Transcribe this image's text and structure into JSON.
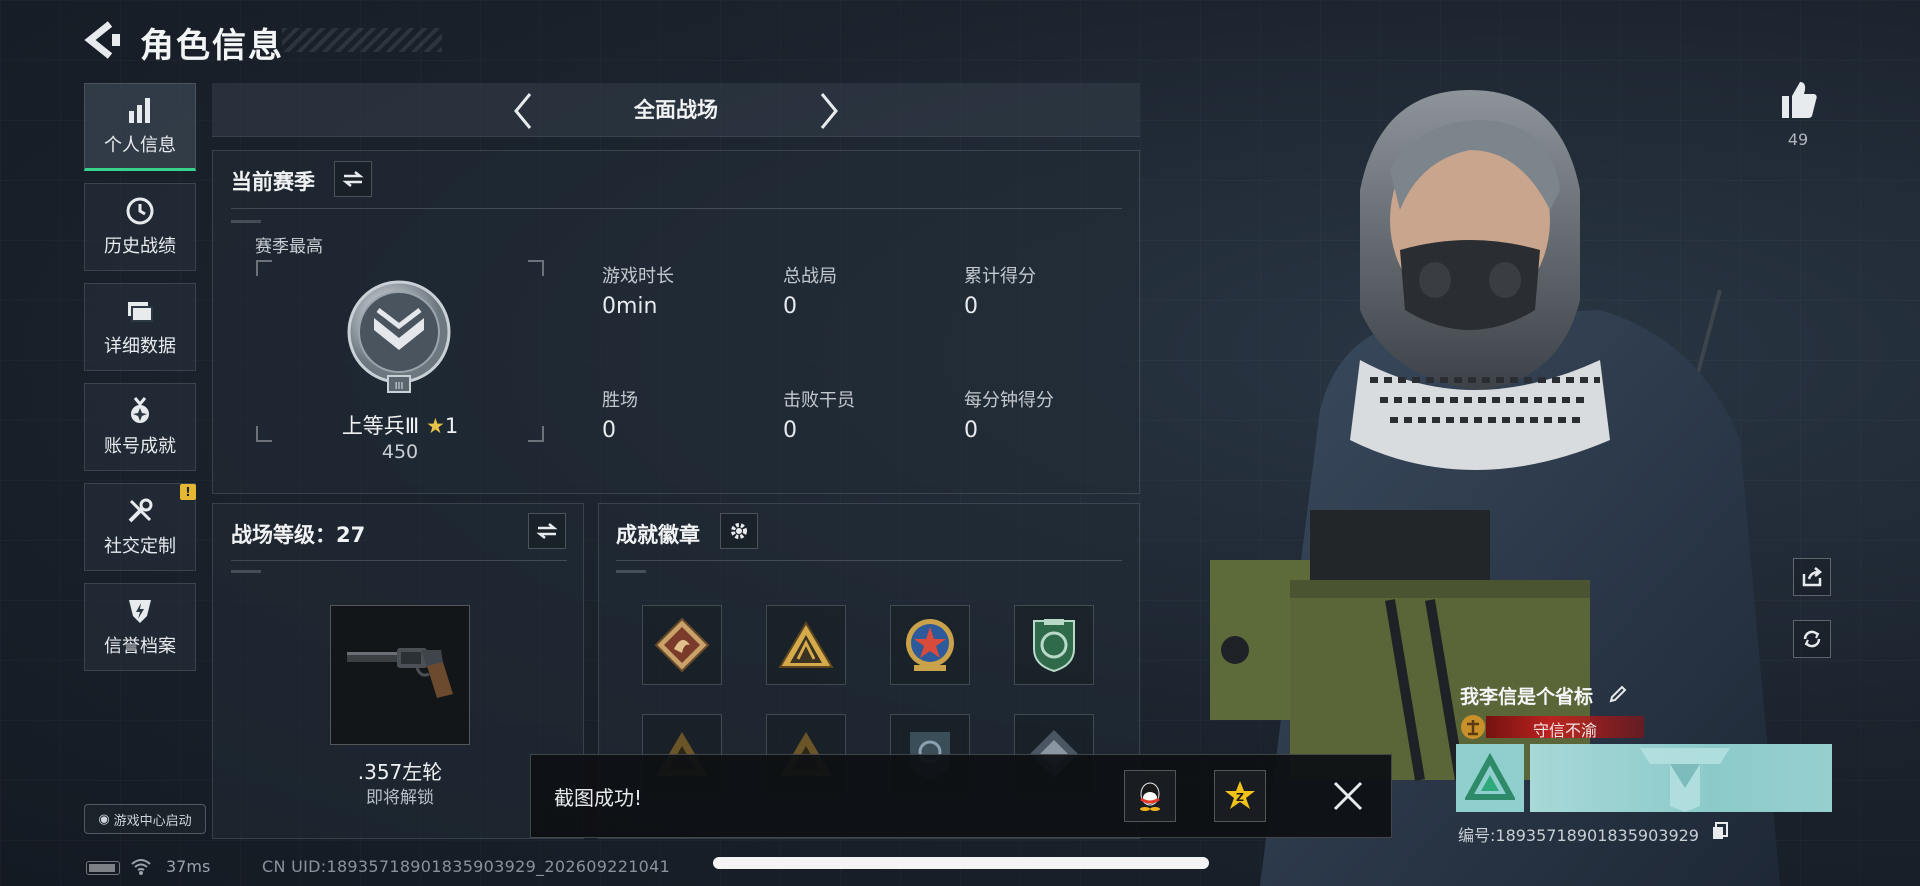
{
  "header": {
    "title": "角色信息"
  },
  "sidebar": {
    "items": [
      {
        "label": "个人信息",
        "icon": "bar-chart-icon",
        "active": true
      },
      {
        "label": "历史战绩",
        "icon": "clock-history-icon"
      },
      {
        "label": "详细数据",
        "icon": "folder-icon"
      },
      {
        "label": "账号成就",
        "icon": "medal-icon"
      },
      {
        "label": "社交定制",
        "icon": "tools-icon",
        "badge": "!"
      },
      {
        "label": "信誉档案",
        "icon": "shield-bolt-icon"
      }
    ],
    "game_center_label": "游戏中心启动"
  },
  "mode_selector": {
    "label": "全面战场"
  },
  "season": {
    "title": "当前赛季",
    "best_label": "赛季最高",
    "rank_name": "上等兵Ⅲ",
    "rank_stars": "1",
    "rank_score": "450",
    "stats": [
      {
        "label": "游戏时长",
        "value": "0min"
      },
      {
        "label": "总战局",
        "value": "0"
      },
      {
        "label": "累计得分",
        "value": "0"
      },
      {
        "label": "胜场",
        "value": "0"
      },
      {
        "label": "击败干员",
        "value": "0"
      },
      {
        "label": "每分钟得分",
        "value": "0"
      }
    ]
  },
  "battlefield_level": {
    "label": "战场等级：",
    "value": "27",
    "weapon_name": ".357左轮",
    "weapon_status": "即将解锁"
  },
  "achievements": {
    "title": "成就徽章"
  },
  "toast": {
    "text": "截图成功!"
  },
  "status": {
    "ping": "37ms",
    "uid": "CN UID:1893571890183590392​9_202609221041"
  },
  "likes": {
    "count": "49"
  },
  "player": {
    "name": "我李信是个省标",
    "title": "守信不渝",
    "id": "编号:18935718901835903929"
  },
  "colors": {
    "accent": "#36d38a",
    "badge": "#e6b832",
    "title_red": "#b81e1e",
    "card_teal": "#8fd0ce"
  }
}
